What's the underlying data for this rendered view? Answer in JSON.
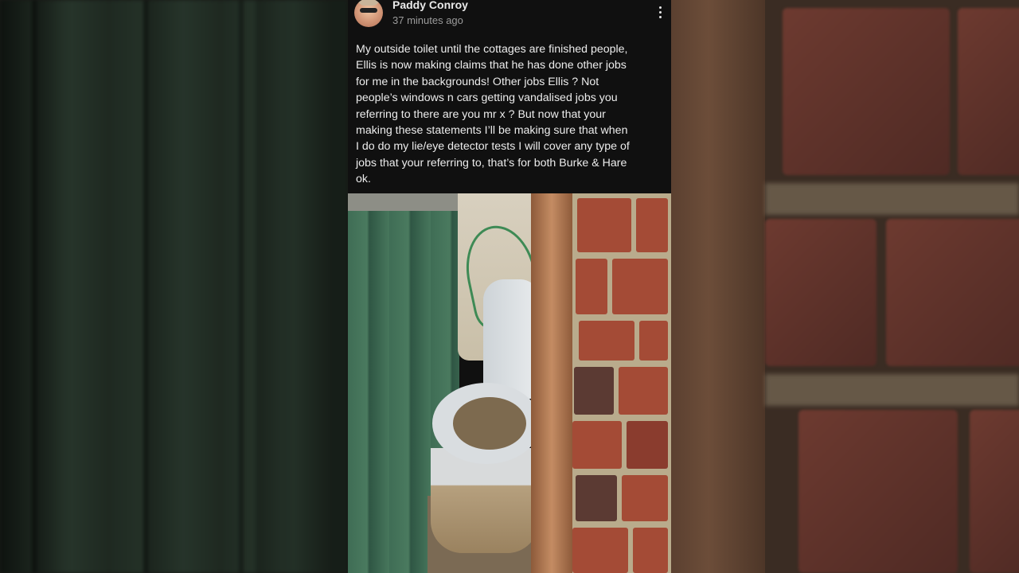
{
  "post": {
    "author": "Paddy Conroy",
    "timestamp": "37 minutes ago",
    "body": "My outside toilet until the cottages are finished people,\nEllis is now making claims that he has done other jobs\nfor me in the backgrounds!  Other jobs Ellis ?  Not\npeople’s windows n cars getting vandalised jobs you\nreferring to there are you mr x ? But now that your\nmaking these statements I’ll be making sure that when\nI do do my lie/eye detector tests I will cover any type of\njobs that your referring to, that’s for both Burke & Hare\nok.",
    "more_menu_icon": "more-vertical-icon"
  },
  "colors": {
    "card_background": "#101010",
    "primary_text": "#ececec",
    "secondary_text": "#9b9b9b"
  }
}
